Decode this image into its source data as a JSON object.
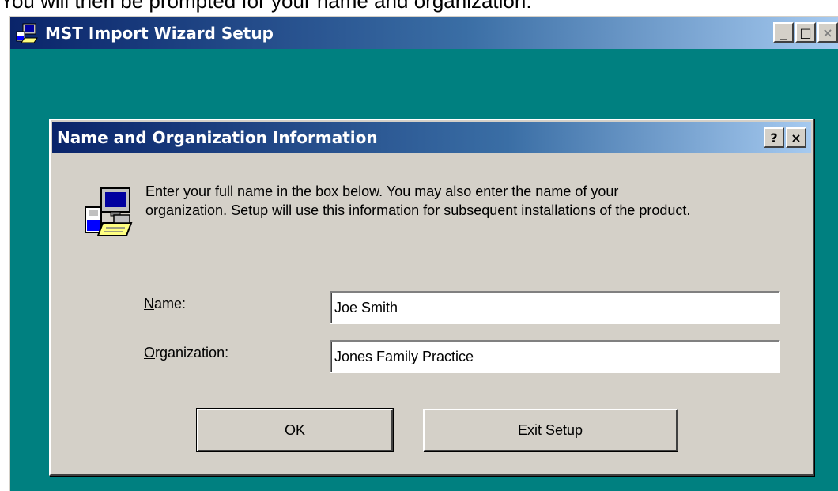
{
  "caption": "You will then be prompted for your name and organization.",
  "outer_window": {
    "title": "MST Import Wizard Setup",
    "icon": "setup-computer-icon",
    "controls": {
      "minimize": "_",
      "maximize": "□",
      "close": "×"
    }
  },
  "dialog": {
    "title": "Name and Organization Information",
    "controls": {
      "help": "?",
      "close": "×"
    },
    "icon": "computer-setup-icon",
    "intro_line1": "Enter your full name in the box below. You may also enter the name of your",
    "intro_line2": "organization. Setup will use this information for subsequent installations of the product.",
    "name_label_acc": "N",
    "name_label_rest": "ame:",
    "name_value": "Joe Smith",
    "org_label_acc": "O",
    "org_label_rest": "rganization:",
    "org_value": "Jones Family Practice",
    "ok_label": "OK",
    "exit_label_pre": "E",
    "exit_label_acc": "x",
    "exit_label_post": "it Setup"
  },
  "colors": {
    "desktop": "#008080",
    "face": "#d4d0c8",
    "title_start": "#0a246a",
    "title_end": "#a6caf0"
  }
}
